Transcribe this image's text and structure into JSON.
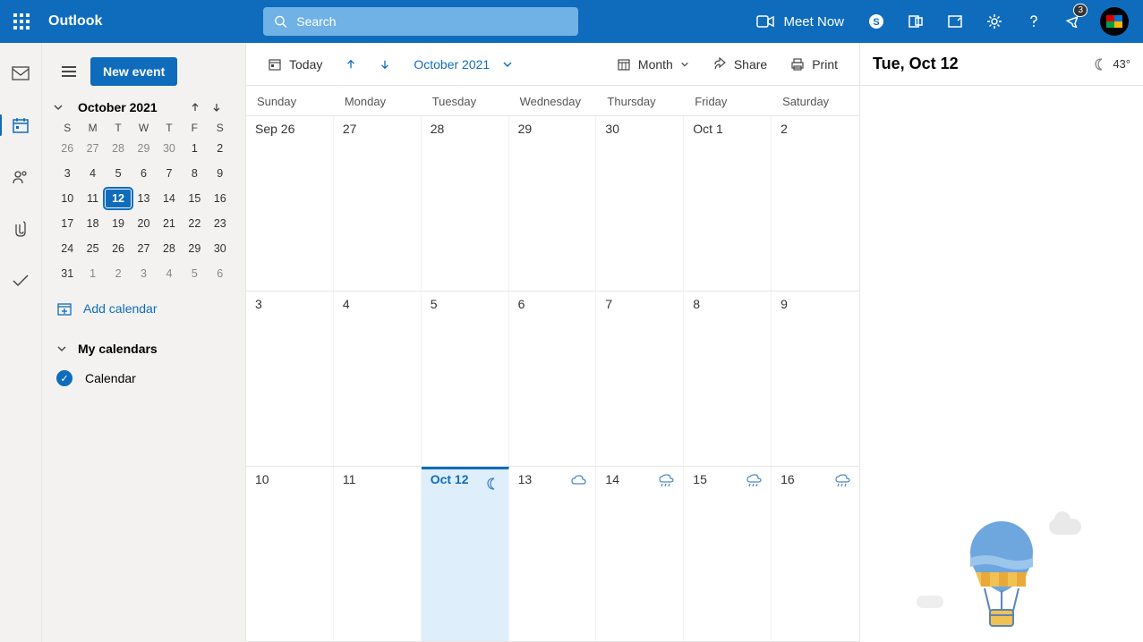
{
  "header": {
    "app_title": "Outlook",
    "search_placeholder": "Search",
    "meet_now": "Meet Now",
    "notif_count": "3"
  },
  "leftrail": {
    "items": [
      "mail",
      "calendar",
      "people",
      "files",
      "todo"
    ]
  },
  "sidebar": {
    "new_event": "New event",
    "month_label": "October 2021",
    "dow": [
      "S",
      "M",
      "T",
      "W",
      "T",
      "F",
      "S"
    ],
    "mini_days": [
      {
        "d": "26",
        "o": true
      },
      {
        "d": "27",
        "o": true
      },
      {
        "d": "28",
        "o": true
      },
      {
        "d": "29",
        "o": true
      },
      {
        "d": "30",
        "o": true
      },
      {
        "d": "1"
      },
      {
        "d": "2"
      },
      {
        "d": "3"
      },
      {
        "d": "4"
      },
      {
        "d": "5"
      },
      {
        "d": "6"
      },
      {
        "d": "7"
      },
      {
        "d": "8"
      },
      {
        "d": "9"
      },
      {
        "d": "10"
      },
      {
        "d": "11"
      },
      {
        "d": "12",
        "today": true
      },
      {
        "d": "13"
      },
      {
        "d": "14"
      },
      {
        "d": "15"
      },
      {
        "d": "16"
      },
      {
        "d": "17"
      },
      {
        "d": "18"
      },
      {
        "d": "19"
      },
      {
        "d": "20"
      },
      {
        "d": "21"
      },
      {
        "d": "22"
      },
      {
        "d": "23"
      },
      {
        "d": "24"
      },
      {
        "d": "25"
      },
      {
        "d": "26"
      },
      {
        "d": "27"
      },
      {
        "d": "28"
      },
      {
        "d": "29"
      },
      {
        "d": "30"
      },
      {
        "d": "31"
      },
      {
        "d": "1",
        "o": true
      },
      {
        "d": "2",
        "o": true
      },
      {
        "d": "3",
        "o": true
      },
      {
        "d": "4",
        "o": true
      },
      {
        "d": "5",
        "o": true
      },
      {
        "d": "6",
        "o": true
      }
    ],
    "add_calendar": "Add calendar",
    "my_calendars": "My calendars",
    "calendar_item": "Calendar"
  },
  "toolbar": {
    "today": "Today",
    "month_label": "October 2021",
    "view_label": "Month",
    "share": "Share",
    "print": "Print"
  },
  "dow_full": [
    "Sunday",
    "Monday",
    "Tuesday",
    "Wednesday",
    "Thursday",
    "Friday",
    "Saturday"
  ],
  "grid": [
    [
      {
        "d": "Sep 26"
      },
      {
        "d": "27"
      },
      {
        "d": "28"
      },
      {
        "d": "29"
      },
      {
        "d": "30"
      },
      {
        "d": "Oct 1"
      },
      {
        "d": "2"
      }
    ],
    [
      {
        "d": "3"
      },
      {
        "d": "4"
      },
      {
        "d": "5"
      },
      {
        "d": "6"
      },
      {
        "d": "7"
      },
      {
        "d": "8"
      },
      {
        "d": "9"
      }
    ],
    [
      {
        "d": "10"
      },
      {
        "d": "11"
      },
      {
        "d": "Oct 12",
        "today": true,
        "weather": "moon"
      },
      {
        "d": "13",
        "weather": "cloud"
      },
      {
        "d": "14",
        "weather": "rain"
      },
      {
        "d": "15",
        "weather": "rain"
      },
      {
        "d": "16",
        "weather": "rain"
      }
    ]
  ],
  "rightpane": {
    "title": "Tue, Oct 12",
    "temp": "43°"
  }
}
